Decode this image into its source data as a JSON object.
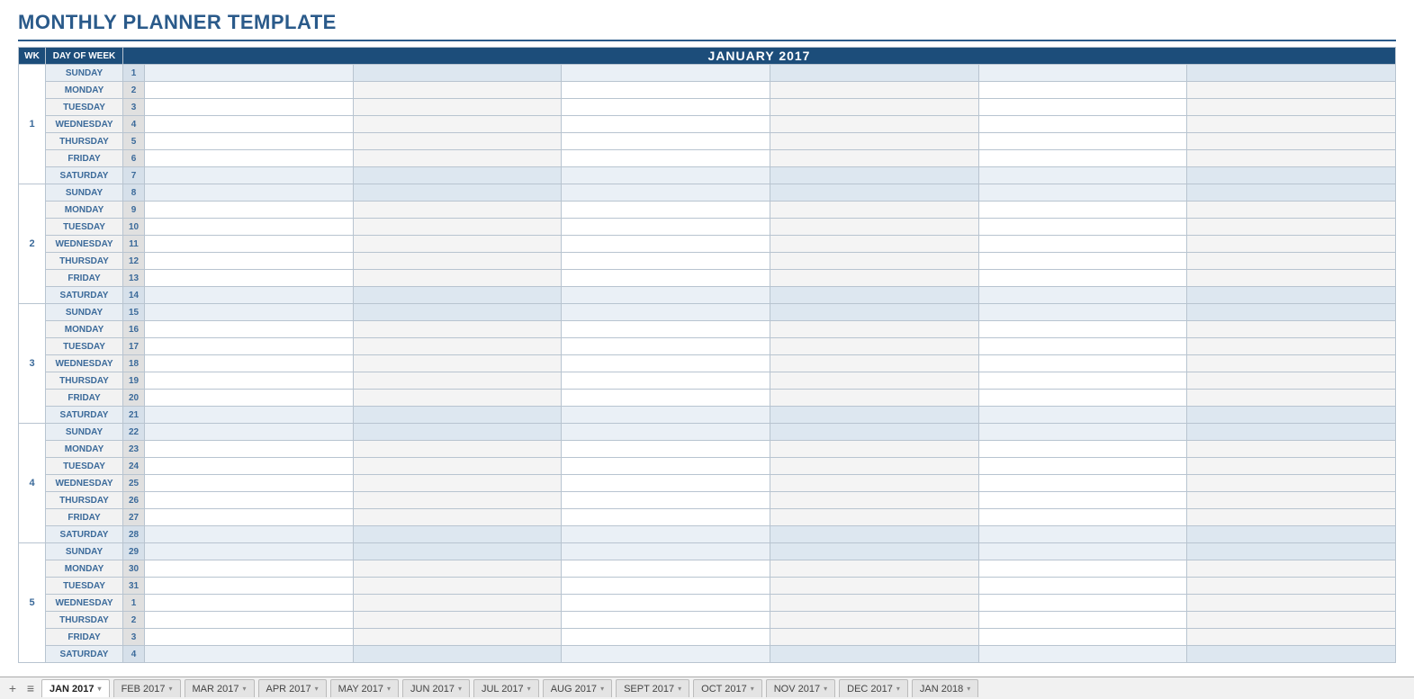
{
  "title": "MONTHLY PLANNER TEMPLATE",
  "headers": {
    "wk": "WK",
    "dow": "DAY OF WEEK",
    "month": "JANUARY 2017"
  },
  "weeks": [
    {
      "num": "1",
      "days": [
        {
          "name": "SUNDAY",
          "date": "1",
          "weekend": true
        },
        {
          "name": "MONDAY",
          "date": "2",
          "weekend": false
        },
        {
          "name": "TUESDAY",
          "date": "3",
          "weekend": false
        },
        {
          "name": "WEDNESDAY",
          "date": "4",
          "weekend": false
        },
        {
          "name": "THURSDAY",
          "date": "5",
          "weekend": false
        },
        {
          "name": "FRIDAY",
          "date": "6",
          "weekend": false
        },
        {
          "name": "SATURDAY",
          "date": "7",
          "weekend": true
        }
      ]
    },
    {
      "num": "2",
      "days": [
        {
          "name": "SUNDAY",
          "date": "8",
          "weekend": true
        },
        {
          "name": "MONDAY",
          "date": "9",
          "weekend": false
        },
        {
          "name": "TUESDAY",
          "date": "10",
          "weekend": false
        },
        {
          "name": "WEDNESDAY",
          "date": "11",
          "weekend": false
        },
        {
          "name": "THURSDAY",
          "date": "12",
          "weekend": false
        },
        {
          "name": "FRIDAY",
          "date": "13",
          "weekend": false
        },
        {
          "name": "SATURDAY",
          "date": "14",
          "weekend": true
        }
      ]
    },
    {
      "num": "3",
      "days": [
        {
          "name": "SUNDAY",
          "date": "15",
          "weekend": true
        },
        {
          "name": "MONDAY",
          "date": "16",
          "weekend": false
        },
        {
          "name": "TUESDAY",
          "date": "17",
          "weekend": false
        },
        {
          "name": "WEDNESDAY",
          "date": "18",
          "weekend": false
        },
        {
          "name": "THURSDAY",
          "date": "19",
          "weekend": false
        },
        {
          "name": "FRIDAY",
          "date": "20",
          "weekend": false
        },
        {
          "name": "SATURDAY",
          "date": "21",
          "weekend": true
        }
      ]
    },
    {
      "num": "4",
      "days": [
        {
          "name": "SUNDAY",
          "date": "22",
          "weekend": true
        },
        {
          "name": "MONDAY",
          "date": "23",
          "weekend": false
        },
        {
          "name": "TUESDAY",
          "date": "24",
          "weekend": false
        },
        {
          "name": "WEDNESDAY",
          "date": "25",
          "weekend": false
        },
        {
          "name": "THURSDAY",
          "date": "26",
          "weekend": false
        },
        {
          "name": "FRIDAY",
          "date": "27",
          "weekend": false
        },
        {
          "name": "SATURDAY",
          "date": "28",
          "weekend": true
        }
      ]
    },
    {
      "num": "5",
      "days": [
        {
          "name": "SUNDAY",
          "date": "29",
          "weekend": true
        },
        {
          "name": "MONDAY",
          "date": "30",
          "weekend": false
        },
        {
          "name": "TUESDAY",
          "date": "31",
          "weekend": false
        },
        {
          "name": "WEDNESDAY",
          "date": "1",
          "weekend": false
        },
        {
          "name": "THURSDAY",
          "date": "2",
          "weekend": false
        },
        {
          "name": "FRIDAY",
          "date": "3",
          "weekend": false
        },
        {
          "name": "SATURDAY",
          "date": "4",
          "weekend": true
        }
      ]
    }
  ],
  "slot_count": 6,
  "tabs": [
    {
      "label": "JAN 2017",
      "active": true
    },
    {
      "label": "FEB 2017",
      "active": false
    },
    {
      "label": "MAR 2017",
      "active": false
    },
    {
      "label": "APR 2017",
      "active": false
    },
    {
      "label": "MAY 2017",
      "active": false
    },
    {
      "label": "JUN 2017",
      "active": false
    },
    {
      "label": "JUL 2017",
      "active": false
    },
    {
      "label": "AUG 2017",
      "active": false
    },
    {
      "label": "SEPT 2017",
      "active": false
    },
    {
      "label": "OCT 2017",
      "active": false
    },
    {
      "label": "NOV 2017",
      "active": false
    },
    {
      "label": "DEC 2017",
      "active": false
    },
    {
      "label": "JAN 2018",
      "active": false
    }
  ]
}
